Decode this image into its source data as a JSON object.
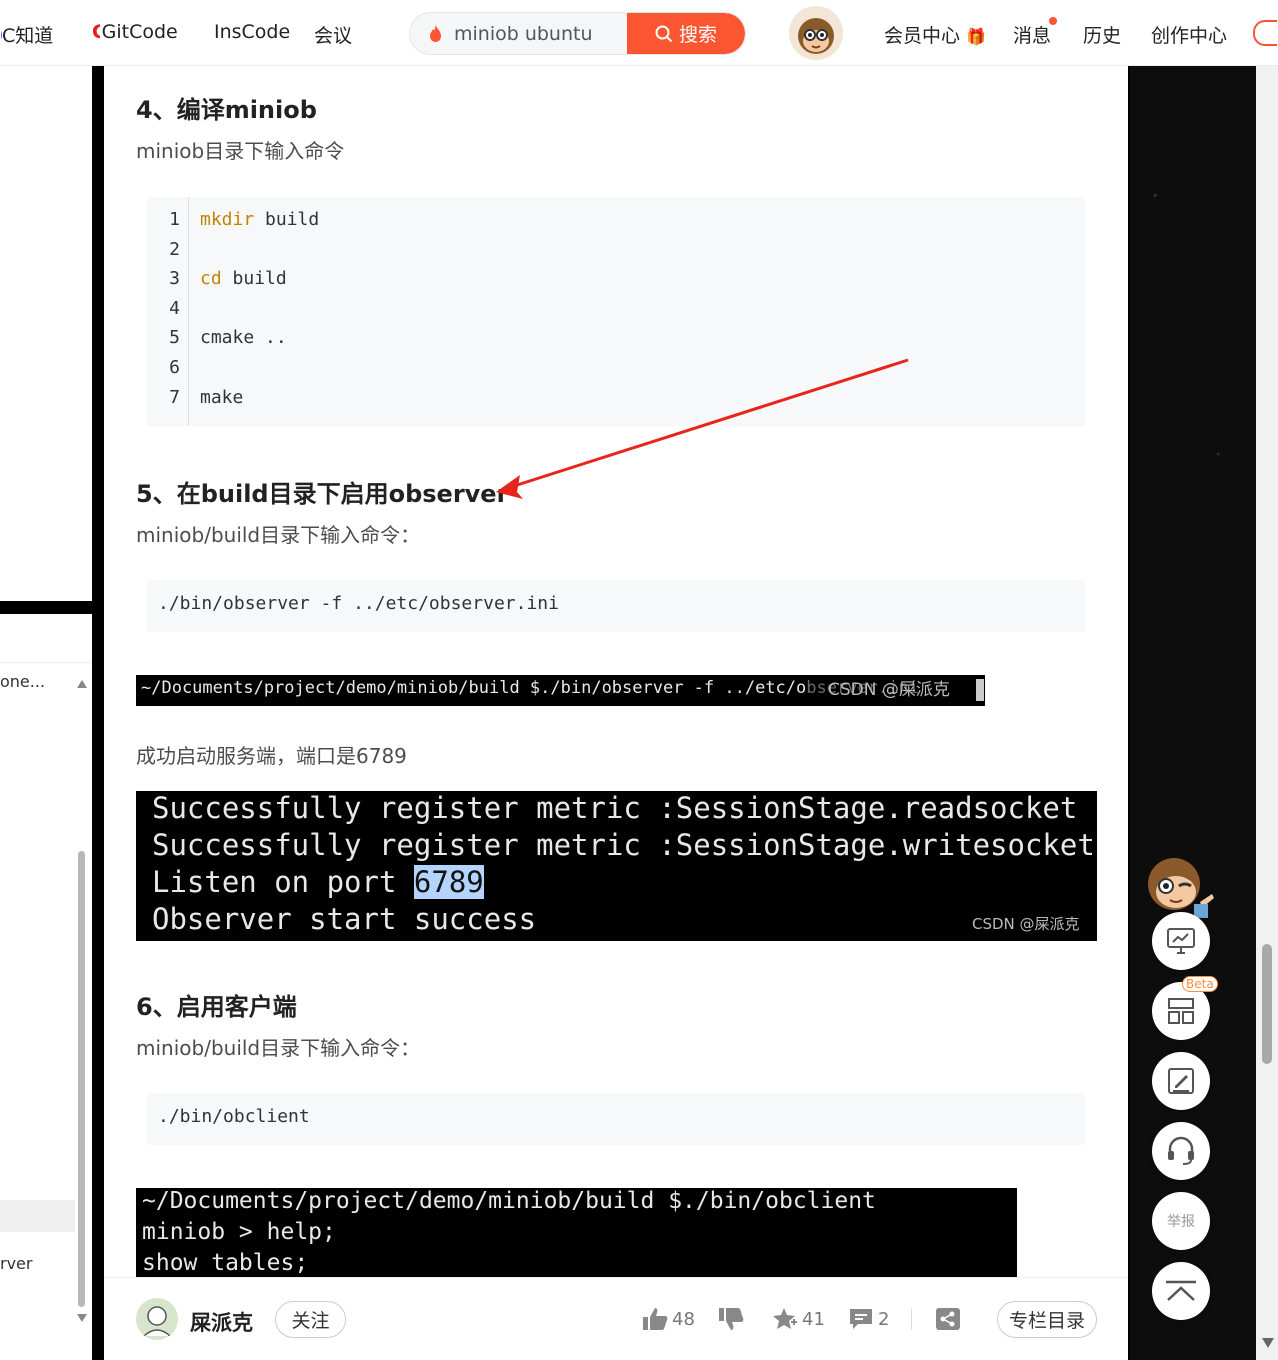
{
  "topbar": {
    "nav": [
      "C知道",
      "GitCode",
      "InsCode",
      "会议"
    ],
    "search_value": "miniob ubuntu",
    "search_button": "搜索",
    "right": [
      "会员中心",
      "消息",
      "历史",
      "创作中心"
    ]
  },
  "sidebar": {
    "item_truncated": "one...",
    "item_bottom": "rver"
  },
  "article": {
    "s4_title": "4、编译miniob",
    "s4_desc": "miniob目录下输入命令",
    "s4_code": [
      {
        "n": "1",
        "kw": "mkdir",
        "rest": " build"
      },
      {
        "n": "2",
        "kw": "",
        "rest": ""
      },
      {
        "n": "3",
        "kw": "cd",
        "rest": " build"
      },
      {
        "n": "4",
        "kw": "",
        "rest": ""
      },
      {
        "n": "5",
        "kw": "",
        "rest": "cmake .."
      },
      {
        "n": "6",
        "kw": "",
        "rest": ""
      },
      {
        "n": "7",
        "kw": "",
        "rest": "make"
      }
    ],
    "s5_title": "5、在build目录下启用observer",
    "s5_desc": "miniob/build目录下输入命令：",
    "s5_code": "./bin/observer -f ../etc/observer.ini",
    "s5_term": "~/Documents/project/demo/miniob/build $./bin/observer -f ../etc/observer.ini",
    "s5_term_wm": "CSDN @屎派克",
    "s5_result": "成功启动服务端，端口是6789",
    "s5_out": {
      "l1": "Successfully register metric :SessionStage.readsocket",
      "l2": "Successfully register metric :SessionStage.writesocket",
      "l3_prefix": "Listen on port ",
      "l3_port": "6789",
      "l4": "Observer start success",
      "wm": "CSDN @屎派克"
    },
    "s6_title": "6、启用客户端",
    "s6_desc": "miniob/build目录下输入命令：",
    "s6_code": "./bin/obclient",
    "s6_term": [
      "~/Documents/project/demo/miniob/build $./bin/obclient",
      "miniob > help;",
      "show tables;"
    ]
  },
  "bottombar": {
    "author": "屎派克",
    "follow": "关注",
    "likes": "48",
    "favorites": "41",
    "comments": "2",
    "column": "专栏目录"
  },
  "tools": {
    "beta": "Beta",
    "report": "举报"
  },
  "colors": {
    "accent": "#fc5531",
    "arrow": "#e8251c",
    "keyword": "#c18401"
  }
}
